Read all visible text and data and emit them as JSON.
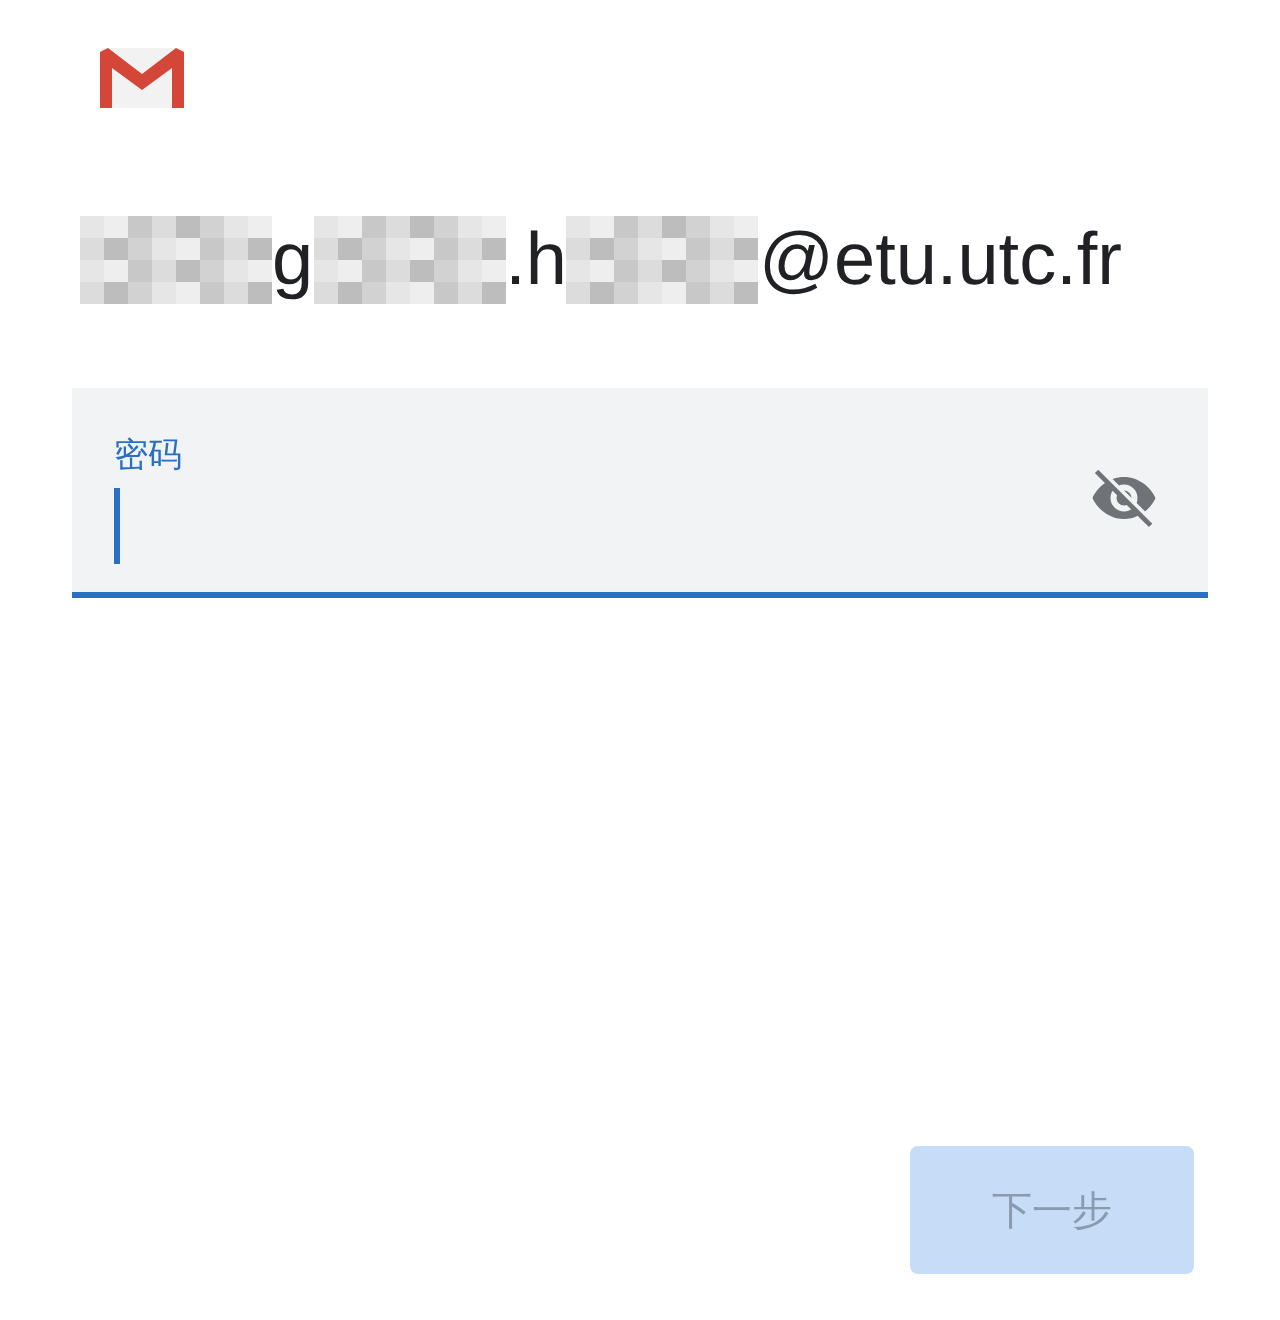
{
  "account_email": {
    "parts": [
      {
        "kind": "redacted"
      },
      {
        "kind": "text",
        "text": "g"
      },
      {
        "kind": "redacted"
      },
      {
        "kind": "text",
        "text": ".h"
      },
      {
        "kind": "redacted"
      },
      {
        "kind": "text",
        "text": "@etu.utc.fr"
      }
    ]
  },
  "password_field": {
    "label": "密码",
    "focused": true,
    "password_visible": false
  },
  "next_button": {
    "label": "下一步",
    "disabled": true
  }
}
